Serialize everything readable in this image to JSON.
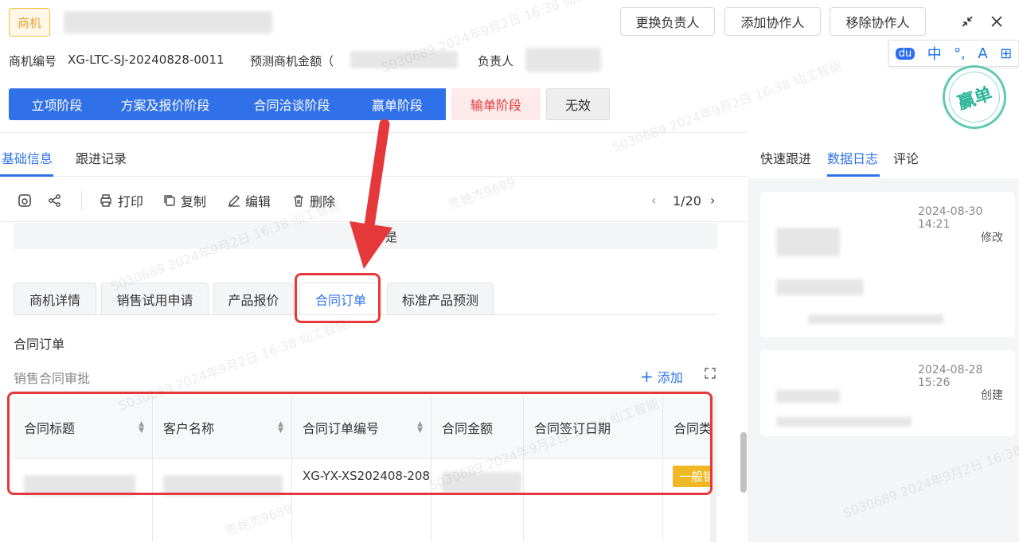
{
  "header": {
    "tag": "商机",
    "buttons": [
      "更换负责人",
      "添加协作人",
      "移除协作人"
    ],
    "meta": {
      "code_label": "商机编号",
      "code_value": "XG-LTC-SJ-20240828-0011",
      "amount_label": "预测商机金额（",
      "owner_label": "负责人"
    },
    "ime": [
      "du",
      "中",
      "°,",
      "A",
      "⊞"
    ]
  },
  "stages": [
    "立项阶段",
    "方案及报价阶段",
    "合同洽谈阶段",
    "赢单阶段"
  ],
  "stage_lose": "输单阶段",
  "stage_invalid": "无效",
  "badge": "赢单",
  "main_tabs": [
    "基础信息",
    "跟进记录"
  ],
  "toolbar": {
    "print": "打印",
    "copy": "复制",
    "edit": "编辑",
    "delete": "删除",
    "pager": "1/20"
  },
  "band_text": "是",
  "sub_tabs": [
    "商机详情",
    "销售试用申请",
    "产品报价",
    "合同订单",
    "标准产品预测"
  ],
  "section": {
    "title": "合同订单",
    "subtitle": "销售合同审批",
    "add": "添加"
  },
  "table": {
    "columns": [
      "合同标题",
      "客户名称",
      "合同订单编号",
      "合同金额",
      "合同签订日期",
      "合同类"
    ],
    "row": {
      "order_no": "XG-YX-XS202408-208",
      "type_tag": "一般销"
    }
  },
  "right": {
    "tabs": [
      "快速跟进",
      "数据日志",
      "评论"
    ],
    "logs": [
      {
        "time": "2024-08-30 14:21",
        "action": "修改"
      },
      {
        "time": "2024-08-28 15:26",
        "action": "创建"
      }
    ]
  },
  "watermark": "S030689 2024年9月2日 16:38 仙工智能",
  "watermark_name": "贾艳杰9689"
}
